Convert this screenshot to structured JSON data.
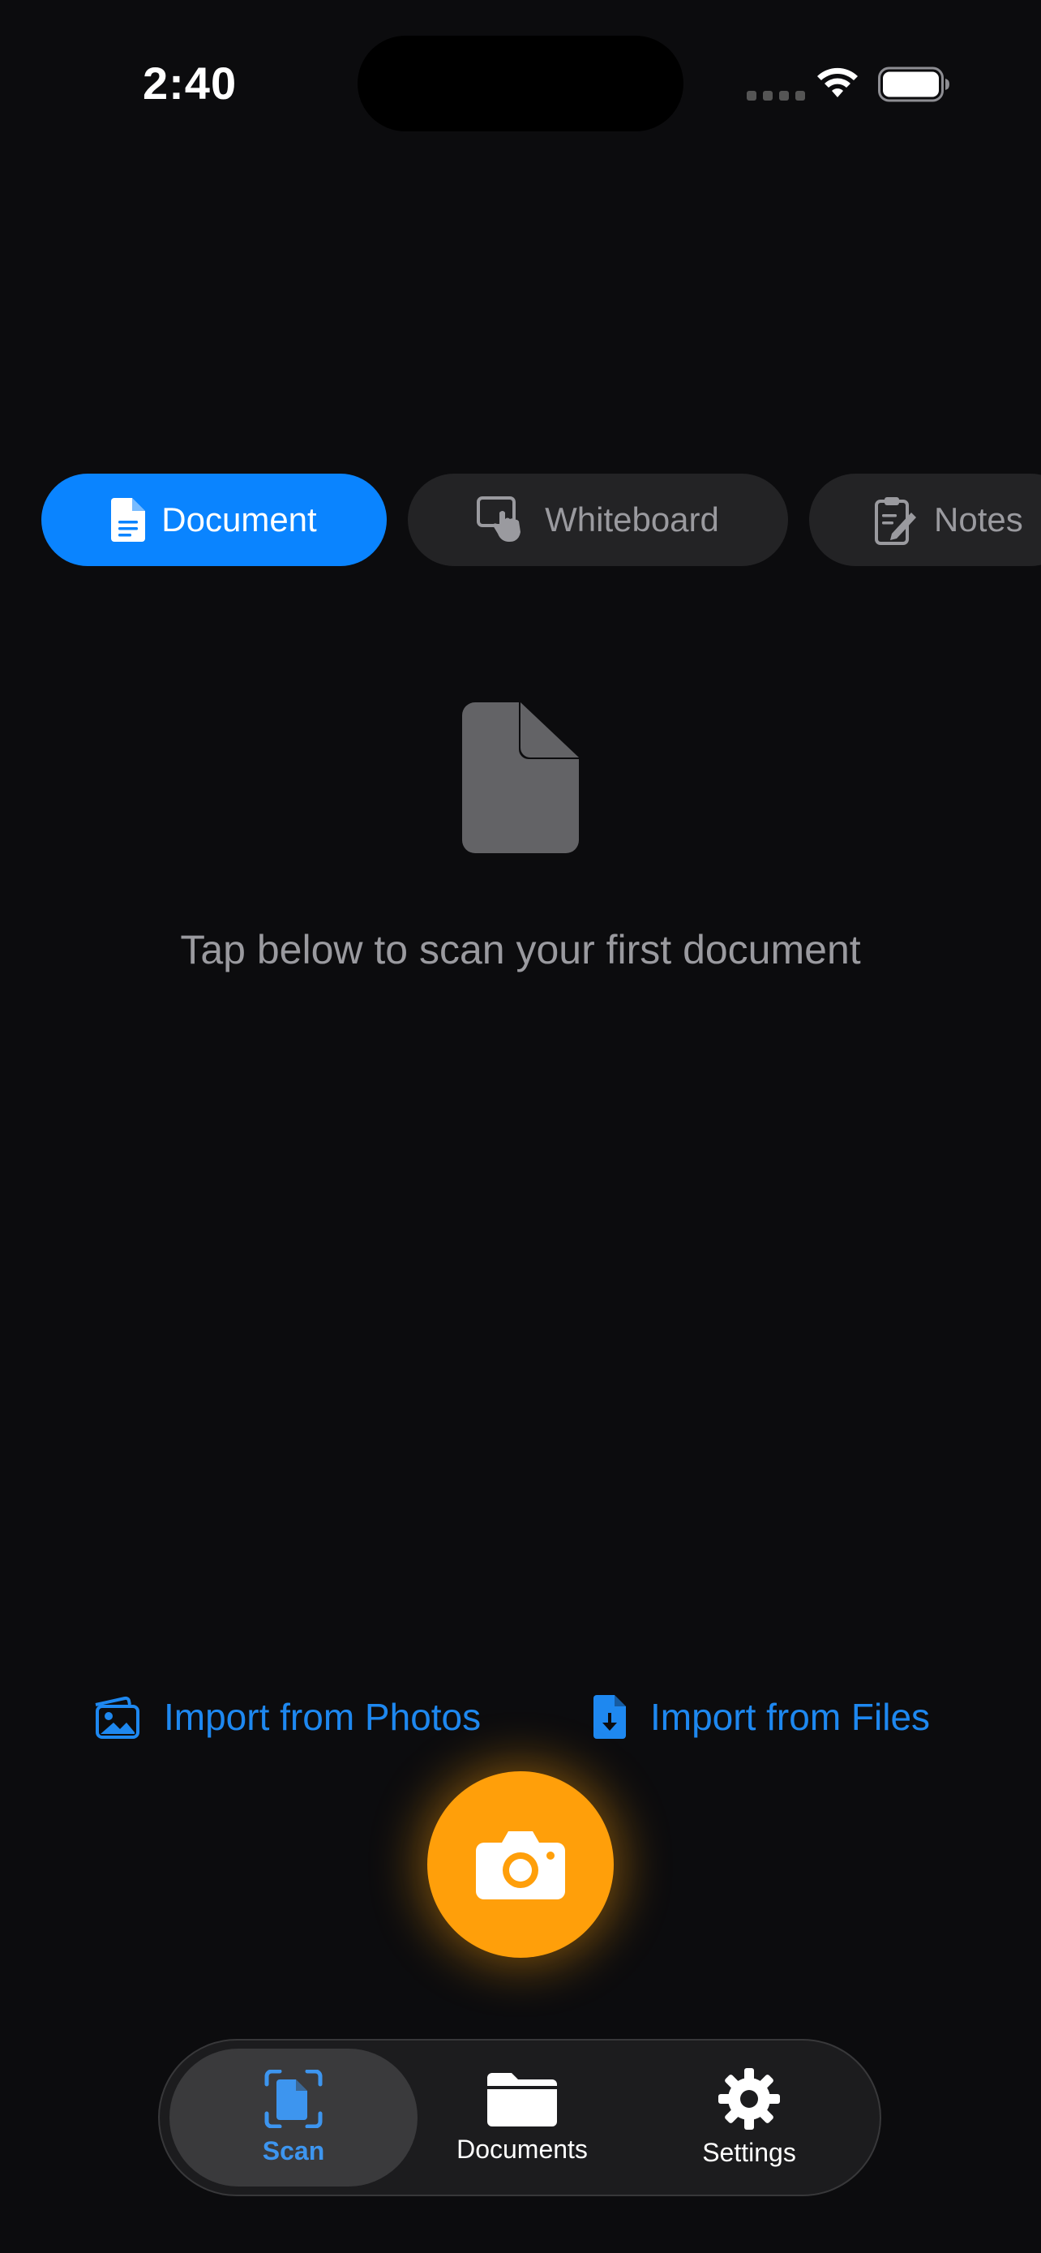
{
  "status_bar": {
    "time": "2:40"
  },
  "modes": [
    {
      "label": "Document",
      "icon": "document-icon",
      "selected": true
    },
    {
      "label": "Whiteboard",
      "icon": "whiteboard-touch-icon",
      "selected": false
    },
    {
      "label": "Notes",
      "icon": "clipboard-pencil-icon",
      "selected": false
    }
  ],
  "empty_state": {
    "icon": "document-icon",
    "message": "Tap below to scan your first document"
  },
  "import": {
    "photos_label": "Import from Photos",
    "files_label": "Import from Files"
  },
  "shutter": {
    "icon": "camera-icon"
  },
  "tabs": [
    {
      "label": "Scan",
      "icon": "scan-document-icon",
      "selected": true
    },
    {
      "label": "Documents",
      "icon": "folder-icon",
      "selected": false
    },
    {
      "label": "Settings",
      "icon": "gear-icon",
      "selected": false
    }
  ],
  "colors": {
    "background": "#0c0c0e",
    "accent_blue": "#0a84ff",
    "link_blue": "#1e88f0",
    "shutter_orange": "#ff9f0a",
    "muted_text": "#9a9a9f"
  }
}
